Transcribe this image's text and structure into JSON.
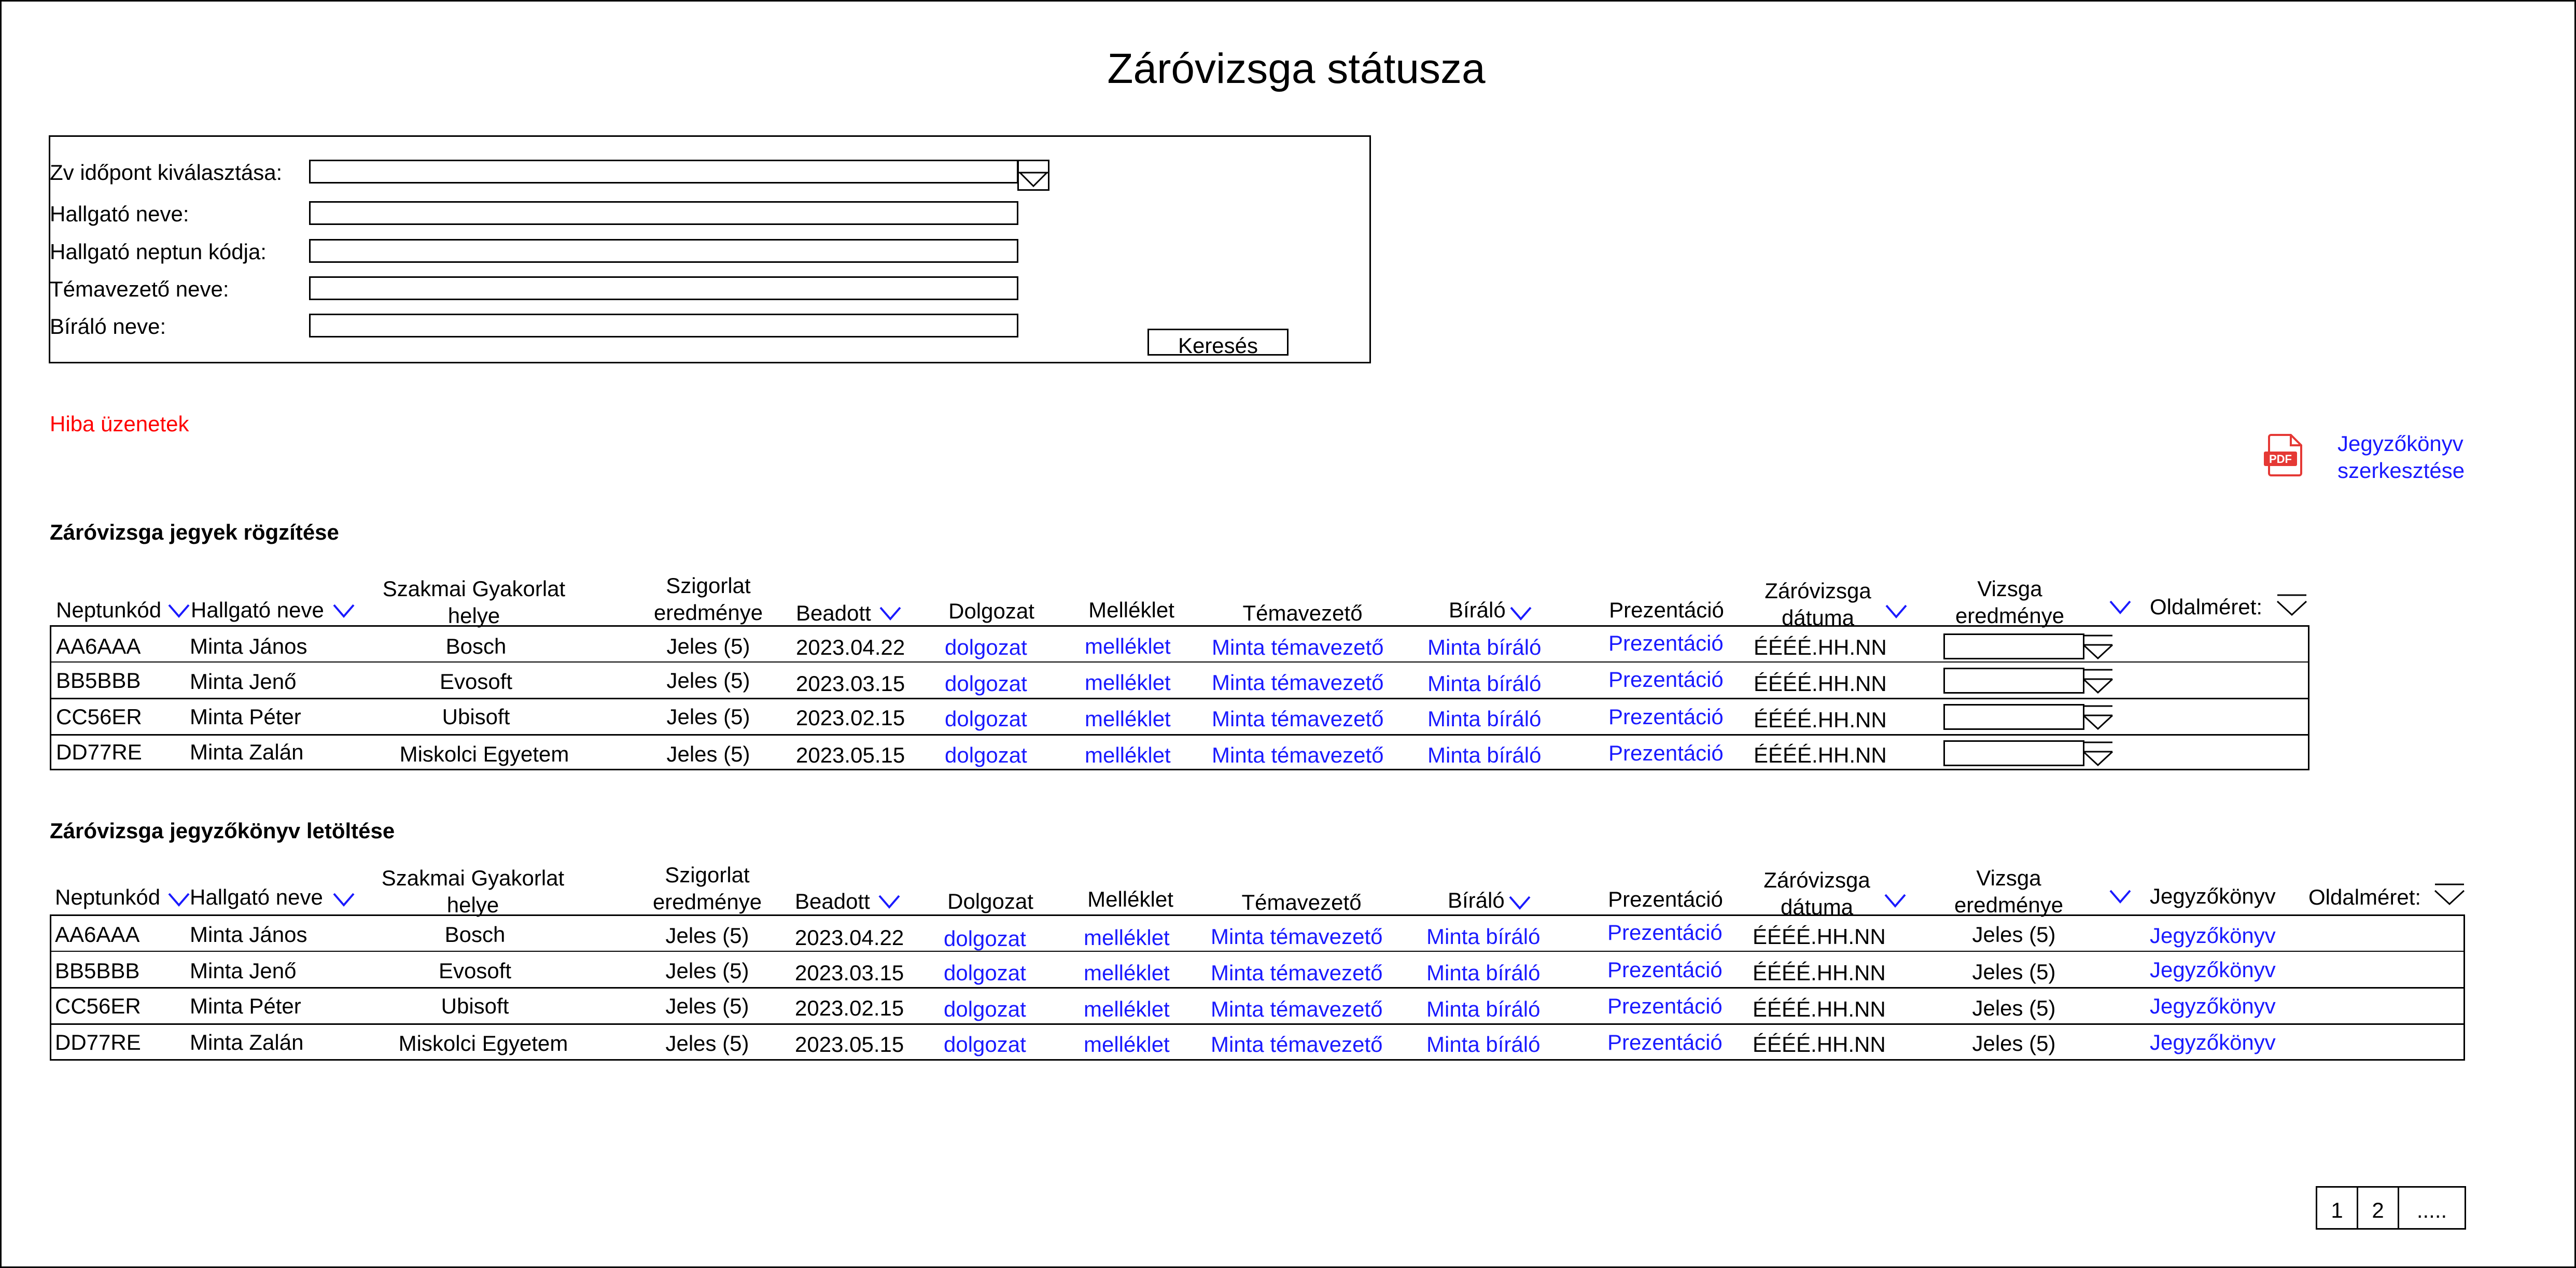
{
  "page": {
    "title": "Záróvizsga státusza"
  },
  "search": {
    "date_label": "Zv időpont kiválasztása:",
    "name_label": "Hallgató neve:",
    "neptun_label": "Hallgató neptun kódja:",
    "supervisor_label": "Témavezető neve:",
    "reviewer_label": "Bíráló neve:",
    "button": "Keresés"
  },
  "errors": {
    "text": "Hiba üzenetek"
  },
  "protocol_edit": {
    "line1": "Jegyzőkönyv",
    "line2": "szerkesztése",
    "icon": "pdf-icon"
  },
  "section1": {
    "title": "Záróvizsga jegyek rögzítése",
    "headers": {
      "neptun": "Neptunkód",
      "name": "Hallgató neve",
      "internship_1": "Szakmai Gyakorlat",
      "internship_2": "helye",
      "grade_1": "Szigorlat",
      "grade_2": "eredménye",
      "submitted": "Beadott",
      "thesis": "Dolgozat",
      "attachment": "Melléklet",
      "supervisor": "Témavezető",
      "reviewer": "Bíráló",
      "presentation": "Prezentáció",
      "date_1": "Záróvizsga",
      "date_2": "dátuma",
      "result_1": "Vizsga",
      "result_2": "eredménye",
      "page_size": "Oldalméret:"
    },
    "rows": [
      {
        "neptun": "AA6AAA",
        "name": "Minta János",
        "internship": "Bosch",
        "grade": "Jeles (5)",
        "submitted": "2023.04.22",
        "thesis": "dolgozat",
        "attachment": "melléklet",
        "supervisor": "Minta témavezető",
        "reviewer": "Minta bíráló",
        "presentation": "Prezentáció",
        "date": "ÉÉÉÉ.HH.NN"
      },
      {
        "neptun": "BB5BBB",
        "name": "Minta Jenő",
        "internship": "Evosoft",
        "grade": "Jeles (5)",
        "submitted": "2023.03.15",
        "thesis": "dolgozat",
        "attachment": "melléklet",
        "supervisor": "Minta témavezető",
        "reviewer": "Minta bíráló",
        "presentation": "Prezentáció",
        "date": "ÉÉÉÉ.HH.NN"
      },
      {
        "neptun": "CC56ER",
        "name": "Minta Péter",
        "internship": "Ubisoft",
        "grade": "Jeles (5)",
        "submitted": "2023.02.15",
        "thesis": "dolgozat",
        "attachment": "melléklet",
        "supervisor": "Minta témavezető",
        "reviewer": "Minta bíráló",
        "presentation": "Prezentáció",
        "date": "ÉÉÉÉ.HH.NN"
      },
      {
        "neptun": "DD77RE",
        "name": "Minta Zalán",
        "internship": "Miskolci Egyetem",
        "grade": "Jeles (5)",
        "submitted": "2023.05.15",
        "thesis": "dolgozat",
        "attachment": "melléklet",
        "supervisor": "Minta témavezető",
        "reviewer": "Minta bíráló",
        "presentation": "Prezentáció",
        "date": "ÉÉÉÉ.HH.NN"
      }
    ]
  },
  "section2": {
    "title": "Záróvizsga jegyzőkönyv letöltése",
    "headers": {
      "neptun": "Neptunkód",
      "name": "Hallgató neve",
      "internship_1": "Szakmai Gyakorlat",
      "internship_2": "helye",
      "grade_1": "Szigorlat",
      "grade_2": "eredménye",
      "submitted": "Beadott",
      "thesis": "Dolgozat",
      "attachment": "Melléklet",
      "supervisor": "Témavezető",
      "reviewer": "Bíráló",
      "presentation": "Prezentáció",
      "date_1": "Záróvizsga",
      "date_2": "dátuma",
      "result_1": "Vizsga",
      "result_2": "eredménye",
      "protocol": "Jegyzőkönyv",
      "page_size": "Oldalméret:"
    },
    "rows": [
      {
        "neptun": "AA6AAA",
        "name": "Minta János",
        "internship": "Bosch",
        "grade": "Jeles (5)",
        "submitted": "2023.04.22",
        "thesis": "dolgozat",
        "attachment": "melléklet",
        "supervisor": "Minta témavezető",
        "reviewer": "Minta bíráló",
        "presentation": "Prezentáció",
        "date": "ÉÉÉÉ.HH.NN",
        "result": "Jeles (5)",
        "protocol": "Jegyzőkönyv"
      },
      {
        "neptun": "BB5BBB",
        "name": "Minta Jenő",
        "internship": "Evosoft",
        "grade": "Jeles (5)",
        "submitted": "2023.03.15",
        "thesis": "dolgozat",
        "attachment": "melléklet",
        "supervisor": "Minta témavezető",
        "reviewer": "Minta bíráló",
        "presentation": "Prezentáció",
        "date": "ÉÉÉÉ.HH.NN",
        "result": "Jeles (5)",
        "protocol": "Jegyzőkönyv"
      },
      {
        "neptun": "CC56ER",
        "name": "Minta Péter",
        "internship": "Ubisoft",
        "grade": "Jeles (5)",
        "submitted": "2023.02.15",
        "thesis": "dolgozat",
        "attachment": "melléklet",
        "supervisor": "Minta témavezető",
        "reviewer": "Minta bíráló",
        "presentation": "Prezentáció",
        "date": "ÉÉÉÉ.HH.NN",
        "result": "Jeles (5)",
        "protocol": "Jegyzőkönyv"
      },
      {
        "neptun": "DD77RE",
        "name": "Minta Zalán",
        "internship": "Miskolci Egyetem",
        "grade": "Jeles (5)",
        "submitted": "2023.05.15",
        "thesis": "dolgozat",
        "attachment": "melléklet",
        "supervisor": "Minta témavezető",
        "reviewer": "Minta bíráló",
        "presentation": "Prezentáció",
        "date": "ÉÉÉÉ.HH.NN",
        "result": "Jeles (5)",
        "protocol": "Jegyzőkönyv"
      }
    ]
  },
  "pagination": {
    "page1": "1",
    "page2": "2",
    "more": "....."
  },
  "colors": {
    "link": "#1a1aff",
    "error": "#ff0000",
    "pdf": "#e53935"
  },
  "icons": {
    "sort": "chevron-down-icon",
    "dropdown": "dropdown-triangle-icon"
  }
}
